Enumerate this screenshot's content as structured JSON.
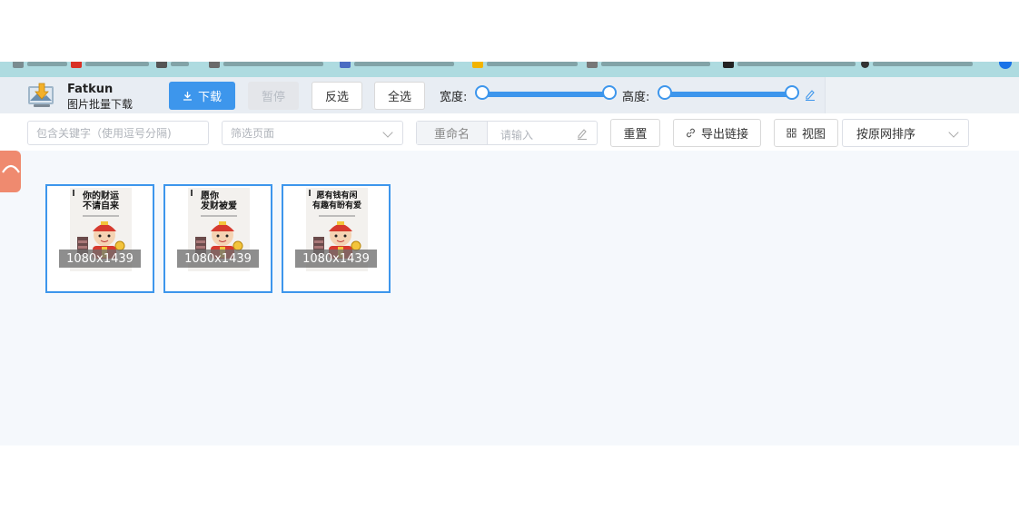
{
  "app": {
    "name": "Fatkun",
    "subtitle": "图片批量下载"
  },
  "toolbar": {
    "download_label": "下载",
    "pause_label": "暂停",
    "invert_label": "反选",
    "select_all_label": "全选",
    "width_label": "宽度:",
    "height_label": "高度:"
  },
  "filter": {
    "keyword_placeholder": "包含关键字（使用逗号分隔)",
    "page_filter_placeholder": "筛选页面",
    "rename_label": "重命名",
    "rename_placeholder": "请输入",
    "reset_label": "重置",
    "export_links_label": "导出链接",
    "view_label": "视图",
    "sort_label": "按原网排序"
  },
  "images": [
    {
      "caption_line1": "你的财运",
      "caption_line2": "不请自来",
      "size": "1080x1439"
    },
    {
      "caption_line1": "愿你",
      "caption_line2": "发财被爱",
      "size": "1080x1439"
    },
    {
      "caption_line1": "愿有钱有闲",
      "caption_line2": "有趣有盼有爱",
      "size": "1080x1439"
    }
  ],
  "colors": {
    "accent": "#3d96ec",
    "side_tab": "#ef8a6f",
    "content_bg": "#f5f8fc"
  }
}
